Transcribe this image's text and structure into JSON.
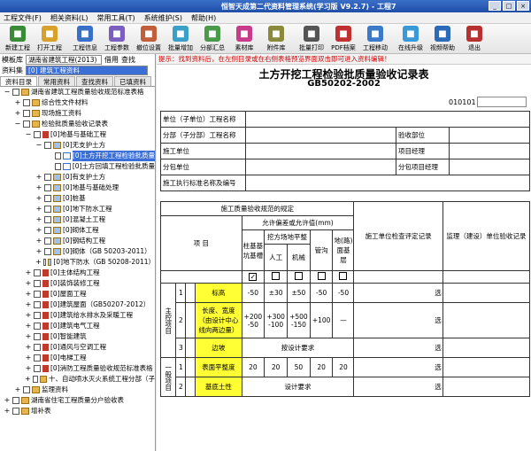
{
  "window": {
    "title": "恒智天成第二代资料管理系统(学习版 V9.2.7) - 工程7",
    "controls": [
      "_",
      "□",
      "×"
    ]
  },
  "menu": [
    "工程文件(F)",
    "相关资料(L)",
    "常用工具(T)",
    "系统维护(S)",
    "帮助(H)"
  ],
  "toolbar": [
    {
      "label": "新建工程",
      "icon": "new-project-icon",
      "color": "#3a8a3a"
    },
    {
      "label": "打开工程",
      "icon": "open-project-icon",
      "color": "#d9a12a"
    },
    {
      "label": "工程信息",
      "icon": "project-info-icon",
      "color": "#3a6fc8"
    },
    {
      "label": "工程参数",
      "icon": "project-params-icon",
      "color": "#7a5fc0"
    },
    {
      "label": "撤位设置",
      "icon": "settings-icon",
      "color": "#c05f3a"
    },
    {
      "label": "批量增加",
      "icon": "batch-add-icon",
      "color": "#3aa0c8"
    },
    {
      "label": "分部汇总",
      "icon": "summary-icon",
      "color": "#4a9a4a"
    },
    {
      "label": "素材库",
      "icon": "material-icon",
      "color": "#c83a8a"
    },
    {
      "label": "附件库",
      "icon": "attachment-icon",
      "color": "#8a8a3a"
    },
    {
      "label": "批量打印",
      "icon": "print-icon",
      "color": "#555555"
    },
    {
      "label": "PDF档案",
      "icon": "pdf-icon",
      "color": "#c03030"
    },
    {
      "label": "工程移动",
      "icon": "move-icon",
      "color": "#3a7ac8"
    },
    {
      "label": "在线升级",
      "icon": "upgrade-icon",
      "color": "#3a9ad8"
    },
    {
      "label": "视频帮助",
      "icon": "video-help-icon",
      "color": "#2a6ab8"
    },
    {
      "label": "退出",
      "icon": "exit-icon",
      "color": "#b83030"
    }
  ],
  "left": {
    "template_label": "模板库",
    "template_value": "湖南省建筑工程(2013)",
    "borrow": "借用",
    "search": "查找",
    "dataset_label": "资料集",
    "dataset_value": "[0] 建筑工程资料",
    "tabs": [
      "资料目录",
      "常用资料",
      "查找资料",
      "已填资料"
    ],
    "tree": [
      {
        "indent": 0,
        "exp": "−",
        "type": "folder",
        "text": "湖南省建筑工程质量验收规范标准表格"
      },
      {
        "indent": 1,
        "exp": "+",
        "type": "folder",
        "text": "综合性文件材料"
      },
      {
        "indent": 1,
        "exp": "+",
        "type": "folder",
        "text": "现场施工资料"
      },
      {
        "indent": 1,
        "exp": "−",
        "type": "folder",
        "text": "检验批质量验收记录表"
      },
      {
        "indent": 2,
        "exp": "−",
        "type": "red",
        "text": "[0]地基与基础工程"
      },
      {
        "indent": 3,
        "exp": "−",
        "type": "sub",
        "text": "[0]无支护土方"
      },
      {
        "indent": 4,
        "exp": "",
        "type": "doc",
        "text": "[0]土方开挖工程检验批质量",
        "sel": true
      },
      {
        "indent": 4,
        "exp": "",
        "type": "doc",
        "text": "[0]土方回填工程检验批质量"
      },
      {
        "indent": 3,
        "exp": "+",
        "type": "sub",
        "text": "[0]有支护土方"
      },
      {
        "indent": 3,
        "exp": "+",
        "type": "sub",
        "text": "[0]地基与基础处理"
      },
      {
        "indent": 3,
        "exp": "+",
        "type": "sub",
        "text": "[0]桩基"
      },
      {
        "indent": 3,
        "exp": "+",
        "type": "sub",
        "text": "[0]地下防水工程"
      },
      {
        "indent": 3,
        "exp": "+",
        "type": "sub",
        "text": "[0]混凝土工程"
      },
      {
        "indent": 3,
        "exp": "+",
        "type": "sub",
        "text": "[0]砌体工程"
      },
      {
        "indent": 3,
        "exp": "+",
        "type": "sub",
        "text": "[0]钢结构工程"
      },
      {
        "indent": 3,
        "exp": "+",
        "type": "sub",
        "text": "[0]砌体（GB 50203-2011）"
      },
      {
        "indent": 3,
        "exp": "+",
        "type": "sub",
        "text": "[0]地下防水（GB 50208-2011）"
      },
      {
        "indent": 2,
        "exp": "+",
        "type": "red",
        "text": "[0]主体结构工程"
      },
      {
        "indent": 2,
        "exp": "+",
        "type": "red",
        "text": "[0]装饰装修工程"
      },
      {
        "indent": 2,
        "exp": "+",
        "type": "red",
        "text": "[0]屋面工程"
      },
      {
        "indent": 2,
        "exp": "+",
        "type": "red",
        "text": "[0]建筑屋面（GB50207-2012）"
      },
      {
        "indent": 2,
        "exp": "+",
        "type": "red",
        "text": "[0]建筑给水排水及采暖工程"
      },
      {
        "indent": 2,
        "exp": "+",
        "type": "red",
        "text": "[0]建筑电气工程"
      },
      {
        "indent": 2,
        "exp": "+",
        "type": "red",
        "text": "[0]智能建筑"
      },
      {
        "indent": 2,
        "exp": "+",
        "type": "red",
        "text": "[0]通风与空调工程"
      },
      {
        "indent": 2,
        "exp": "+",
        "type": "red",
        "text": "[0]电梯工程"
      },
      {
        "indent": 2,
        "exp": "+",
        "type": "red",
        "text": "[0]消防工程质量验收规范标准表格"
      },
      {
        "indent": 2,
        "exp": "+",
        "type": "folder",
        "text": "十、自动喷水灭火系统工程分部（子"
      },
      {
        "indent": 1,
        "exp": "+",
        "type": "folder",
        "text": "监理资料"
      },
      {
        "indent": 0,
        "exp": "+",
        "type": "folder",
        "text": "湖南省住宅工程质量分户验收表"
      },
      {
        "indent": 0,
        "exp": "+",
        "type": "folder",
        "text": "增补表"
      }
    ]
  },
  "right": {
    "hint": "提示：找到资料后，在左侧目录或在右侧表格预览界面双击即可进入资料编辑！",
    "title": "土方开挖工程检验批质量验收记录表",
    "subtitle": "GB50202-2002",
    "code": "010101",
    "form": {
      "unit": "单位（子单位）工程名称",
      "sub": "分部（子分部）工程名称",
      "acceptance_part": "验收部位",
      "construct_unit": "施工单位",
      "project_manager": "项目经理",
      "subcontract_unit": "分包单位",
      "sub_manager": "分包项目经理",
      "standard": "施工执行标准名称及编号"
    },
    "grid": {
      "spec_header": "施工质量验收规范的规定",
      "allow_header": "允许偏差或允许值(mm)",
      "col_pile": "柱基基坑基槽",
      "col_dig": "挖方场地平整",
      "col_man": "人工",
      "col_mech": "机械",
      "col_pipe": "管沟",
      "col_ground": "地(路)面基层",
      "item": "项    目",
      "check_record": "施工单位检查评定记录",
      "supervise_record": "监理（建设）单位验收记录",
      "main_label": "主控项目",
      "general_label": "一般项目",
      "rows": [
        {
          "n": "1",
          "name": "标高",
          "v": [
            "-50",
            "±30",
            "±50",
            "-50",
            "-50"
          ]
        },
        {
          "n": "2",
          "name": "长度、宽度（由设计中心线向两边量）",
          "v": [
            "+200\n-50",
            "+300\n-100",
            "+500\n-150",
            "+100",
            "—"
          ]
        },
        {
          "n": "3",
          "name": "边坡",
          "span": "按设计要求"
        },
        {
          "n": "1",
          "name": "表面平整度",
          "v": [
            "20",
            "20",
            "50",
            "20",
            "20"
          ]
        },
        {
          "n": "2",
          "name": "基底土性",
          "span": "设计要求"
        }
      ],
      "select_mark": "选"
    }
  }
}
